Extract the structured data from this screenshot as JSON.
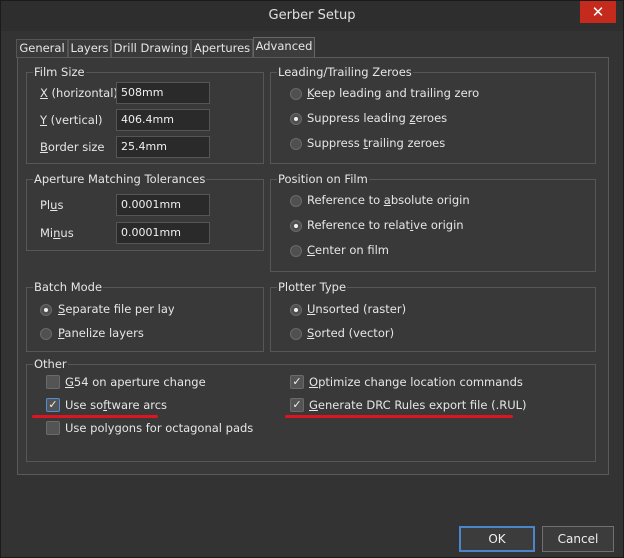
{
  "window": {
    "title": "Gerber Setup",
    "close_glyph": "✕"
  },
  "tabs": [
    {
      "label": "General",
      "active": false
    },
    {
      "label": "Layers",
      "active": false
    },
    {
      "label": "Drill Drawing",
      "active": false
    },
    {
      "label": "Apertures",
      "active": false
    },
    {
      "label": "Advanced",
      "active": true
    }
  ],
  "film_size": {
    "title": "Film Size",
    "x": {
      "key": "X",
      "rest": " (horizontal)",
      "value": "508mm"
    },
    "y": {
      "key": "Y",
      "rest": " (vertical)",
      "value": "406.4mm"
    },
    "border": {
      "key": "B",
      "rest": "order size",
      "value": "25.4mm"
    }
  },
  "aperture": {
    "title": "Aperture Matching Tolerances",
    "plus": {
      "pre": "Pl",
      "key": "u",
      "post": "s",
      "value": "0.0001mm"
    },
    "minus": {
      "pre": "Mi",
      "key": "n",
      "post": "us",
      "value": "0.0001mm"
    }
  },
  "batch": {
    "title": "Batch Mode",
    "separate": {
      "key": "S",
      "rest": "eparate file per layer",
      "selected": true
    },
    "panelize": {
      "key": "P",
      "rest": "anelize layers",
      "selected": false
    }
  },
  "zeroes": {
    "title": "Leading/Trailing Zeroes",
    "keep": {
      "key": "K",
      "rest": "eep leading and trailing zero",
      "selected": false
    },
    "suppress_leading": {
      "pre": "Suppress leading ",
      "key": "z",
      "post": "eroes",
      "selected": true
    },
    "suppress_trailing": {
      "pre": "Suppress ",
      "key": "t",
      "post": "railing zeroes",
      "selected": false
    }
  },
  "position": {
    "title": "Position on Film",
    "absolute": {
      "pre": "Reference to ",
      "key": "a",
      "post": "bsolute origin",
      "selected": false
    },
    "relative": {
      "pre": "Reference to relat",
      "key": "i",
      "post": "ve origin",
      "selected": true
    },
    "center": {
      "key": "C",
      "rest": "enter on film",
      "selected": false
    }
  },
  "plotter": {
    "title": "Plotter Type",
    "unsorted": {
      "key": "U",
      "rest": "nsorted (raster)",
      "selected": true
    },
    "sorted": {
      "key": "S",
      "rest": "orted (vector)",
      "selected": false
    }
  },
  "other": {
    "title": "Other",
    "g54": {
      "key": "G",
      "rest": "54 on aperture change",
      "checked": false
    },
    "software_arcs": {
      "pre": "Use so",
      "key": "f",
      "post": "tware arcs",
      "checked": true
    },
    "polygons": {
      "label": "Use polygons for octagonal pads",
      "checked": false
    },
    "optimize": {
      "pre": "",
      "key": "O",
      "post": "ptimize change location commands",
      "checked": true
    },
    "drc": {
      "key": "G",
      "rest": "enerate DRC Rules export file (.RUL)",
      "checked": true
    },
    "check_glyph": "✓"
  },
  "buttons": {
    "ok": "OK",
    "cancel": "Cancel"
  },
  "colors": {
    "annotation_red": "#e0141e",
    "focus_blue": "#4a86c8",
    "close_red": "#c42b1c"
  }
}
